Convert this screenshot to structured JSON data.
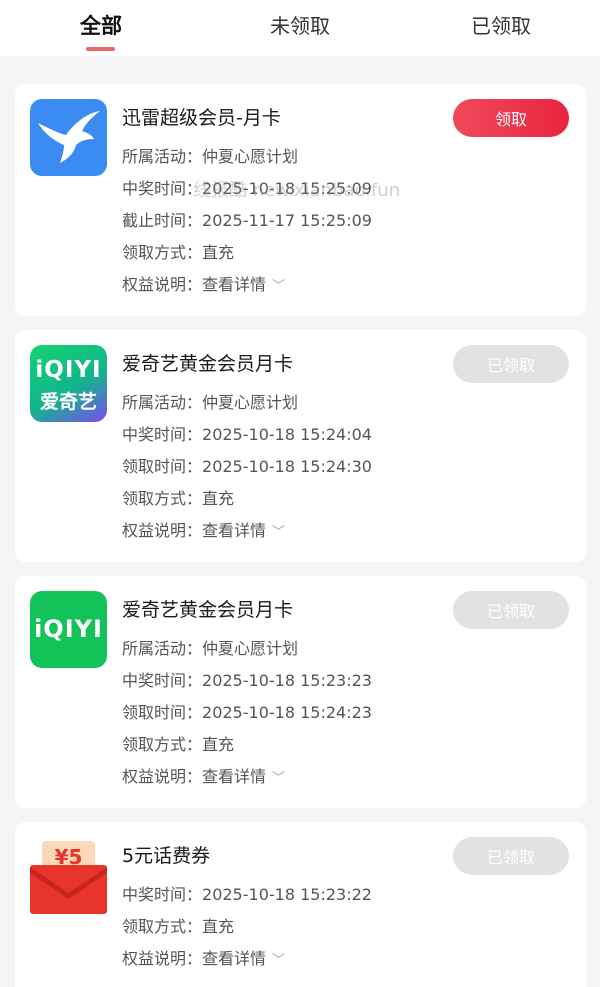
{
  "tabs": [
    {
      "label": "全部",
      "active": true
    },
    {
      "label": "未领取",
      "active": false
    },
    {
      "label": "已领取",
      "active": false
    }
  ],
  "watermark": "线报酷 new.xianbao.fun",
  "cards": [
    {
      "title": "迅雷超级会员-月卡",
      "logo": "thunder-bird-icon",
      "button": "领取",
      "rows": [
        {
          "label": "所属活动：",
          "value": "仲夏心愿计划"
        },
        {
          "label": "中奖时间：",
          "value": "2025-10-18 15:25:09"
        },
        {
          "label": "截止时间：",
          "value": "2025-11-17 15:25:09"
        },
        {
          "label": "领取方式：",
          "value": "直充"
        },
        {
          "label": "权益说明：",
          "value": "查看详情"
        }
      ]
    },
    {
      "title": "爱奇艺黄金会员月卡",
      "logo": "iqiyi-gradient-logo",
      "logo_text1": "iQIYI",
      "logo_text2": "爱奇艺",
      "button": "已领取",
      "rows": [
        {
          "label": "所属活动：",
          "value": "仲夏心愿计划"
        },
        {
          "label": "中奖时间：",
          "value": "2025-10-18 15:24:04"
        },
        {
          "label": "领取时间：",
          "value": "2025-10-18 15:24:30"
        },
        {
          "label": "领取方式：",
          "value": "直充"
        },
        {
          "label": "权益说明：",
          "value": "查看详情"
        }
      ]
    },
    {
      "title": "爱奇艺黄金会员月卡",
      "logo": "iqiyi-green-logo",
      "logo_text1": "iQIYI",
      "button": "已领取",
      "rows": [
        {
          "label": "所属活动：",
          "value": "仲夏心愿计划"
        },
        {
          "label": "中奖时间：",
          "value": "2025-10-18 15:23:23"
        },
        {
          "label": "领取时间：",
          "value": "2025-10-18 15:24:23"
        },
        {
          "label": "领取方式：",
          "value": "直充"
        },
        {
          "label": "权益说明：",
          "value": "查看详情"
        }
      ]
    },
    {
      "title": "5元话费券",
      "logo": "red-envelope-icon",
      "logo_text1": "¥5",
      "button": "已领取",
      "rows": [
        {
          "label": "中奖时间：",
          "value": "2025-10-18 15:23:22"
        },
        {
          "label": "领取方式：",
          "value": "直充"
        },
        {
          "label": "权益说明：",
          "value": "查看详情"
        }
      ]
    }
  ]
}
